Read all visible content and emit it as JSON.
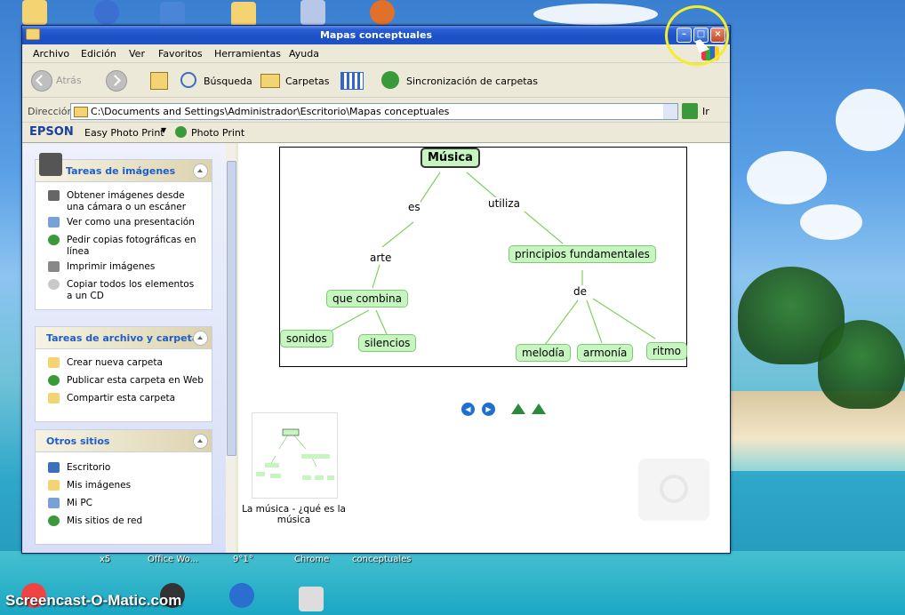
{
  "window": {
    "title": "Mapas conceptuales"
  },
  "menu": [
    "Archivo",
    "Edición",
    "Ver",
    "Favoritos",
    "Herramientas",
    "Ayuda"
  ],
  "toolbar": {
    "back": "Atrás",
    "search": "Búsqueda",
    "folders": "Carpetas",
    "sync": "Sincronización de carpetas"
  },
  "address": {
    "label": "Dirección",
    "path": "C:\\Documents and Settings\\Administrador\\Escritorio\\Mapas conceptuales",
    "go": "Ir"
  },
  "epson": {
    "brand": "EPSON",
    "easy_photo_print": "Easy Photo Print",
    "photo_print": "Photo Print"
  },
  "sidebar": {
    "image_tasks": {
      "title": "Tareas de imágenes",
      "items": [
        "Obtener imágenes desde una cámara o un escáner",
        "Ver como una presentación",
        "Pedir copias fotográficas en línea",
        "Imprimir imágenes",
        "Copiar todos los elementos a un CD"
      ]
    },
    "file_tasks": {
      "title": "Tareas de archivo y carpeta",
      "items": [
        "Crear nueva carpeta",
        "Publicar esta carpeta en Web",
        "Compartir esta carpeta"
      ]
    },
    "other_places": {
      "title": "Otros sitios",
      "items": [
        "Escritorio",
        "Mis imágenes",
        "Mi PC",
        "Mis sitios de red"
      ]
    }
  },
  "concept_map": {
    "root": "Música",
    "links": [
      "es",
      "utiliza",
      "arte",
      "de"
    ],
    "nodes": [
      "que combina",
      "sonidos",
      "silencios",
      "principios fundamentales",
      "melodía",
      "armonía",
      "ritmo"
    ]
  },
  "file": {
    "name": "La música - ¿qué es la música"
  },
  "desktop": {
    "taskbar_labels": [
      "x5",
      "Office Wo...",
      "9°1°",
      "Chrome",
      "conceptuales"
    ],
    "watermark": "Screencast-O-Matic.com"
  },
  "colors": {
    "title_bar": "#1c4fc4",
    "node_fill": "#c6f5c0",
    "panel_title": "#215dc6",
    "highlight_ring": "#f3ee2a"
  }
}
